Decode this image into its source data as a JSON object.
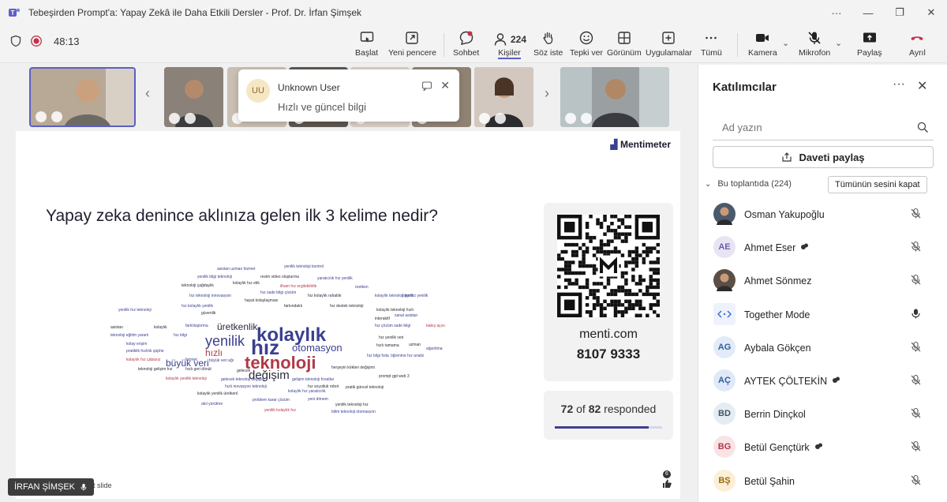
{
  "window": {
    "title": "Tebeşirden Prompt'a: Yapay Zekâ ile Daha Etkili Dersler - Prof. Dr. İrfan Şimşek",
    "controls": {
      "more": "···",
      "minimize": "—",
      "restore": "❐",
      "close": "✕"
    }
  },
  "toolbar": {
    "timer": "48:13",
    "items": {
      "baslat": "Başlat",
      "yeni_pencere": "Yeni pencere",
      "sohbet": "Sohbet",
      "kisiler": "Kişiler",
      "kisiler_count": "224",
      "soz_iste": "Söz iste",
      "tepki_ver": "Tepki ver",
      "gorunum": "Görünüm",
      "uygulamalar": "Uygulamalar",
      "tumu": "Tümü",
      "kamera": "Kamera",
      "mikrofon": "Mikrofon",
      "paylas": "Paylaş",
      "ayril": "Ayrıl"
    },
    "colors": {
      "leave": "#c4314b",
      "record": "#c4314b",
      "accent": "#5b5fc7"
    }
  },
  "popup": {
    "initials": "UU",
    "name": "Unknown User",
    "message": "Hızlı ve güncel bilgi"
  },
  "stage": {
    "brand": "Mentimeter",
    "question": "Yapay zeka denince aklınıza gelen ilk 3 kelime nedir?",
    "menti_url": "menti.com",
    "menti_code": "8107 9333",
    "responded_count": "72",
    "of_word": "of",
    "responded_total": "82",
    "responded_word": "responded",
    "responded_fraction": 0.878,
    "next_slide": "Next slide",
    "reaction_count": "6",
    "word_cloud": [
      {
        "text": "teknoloji",
        "color": "#b03a48"
      },
      {
        "text": "kolaylık",
        "color": "#3a3f8f"
      },
      {
        "text": "hız",
        "color": "#3a3f8f"
      },
      {
        "text": "yenilik",
        "color": "#3a3f8f"
      },
      {
        "text": "değişim",
        "color": "#2a2a3a"
      },
      {
        "text": "otomasyon",
        "color": "#3a3f8f"
      },
      {
        "text": "büyük veri",
        "color": "#3a3f8f"
      },
      {
        "text": "üretkenlik",
        "color": "#2a2a3a"
      },
      {
        "text": "hızlı",
        "color": "#b03a48"
      },
      {
        "text": "asistan uzman hizmet",
        "color": "#3a3f8f"
      },
      {
        "text": "yenilik teknoloji kontrol",
        "color": "#3a3f8f"
      },
      {
        "text": "yenilik bilgi teknoloji",
        "color": "#3a3f8f"
      },
      {
        "text": "resim video oluşturma",
        "color": "#2a2a3a"
      },
      {
        "text": "yaratıcılık hız yenilik",
        "color": "#3a3f8f"
      },
      {
        "text": "kolaylık hız etik",
        "color": "#2a2a3a"
      },
      {
        "text": "teknoloji çağdaşlık",
        "color": "#2a2a3a"
      },
      {
        "text": "ilham hız ergilebilirlik",
        "color": "#b03a48"
      },
      {
        "text": "üretken",
        "color": "#3a3f8f"
      },
      {
        "text": "bilgi hız yenilik",
        "color": "#3a3f8f"
      },
      {
        "text": "hız teknoloji innovasyon",
        "color": "#3a3f8f"
      },
      {
        "text": "hız sade bilgi çözüm",
        "color": "#3a3f8f"
      },
      {
        "text": "hız kolaylık rahatlık",
        "color": "#2a2a3a"
      },
      {
        "text": "kolaylık teknoloji yenili",
        "color": "#3a3f8f"
      },
      {
        "text": "hayat kolaylaşması",
        "color": "#2a2a3a"
      },
      {
        "text": "hız kolaylık yenilik",
        "color": "#3a3f8f"
      },
      {
        "text": "farkındalık",
        "color": "#2a2a3a"
      },
      {
        "text": "hız destek teknoloji",
        "color": "#2a2a3a"
      },
      {
        "text": "kolaylık teknoloji hızlı",
        "color": "#2a2a3a"
      },
      {
        "text": "yenilik hız teknoloji",
        "color": "#3a3f8f"
      },
      {
        "text": "güvenlik",
        "color": "#2a2a3a"
      },
      {
        "text": "interaktif",
        "color": "#2a2a3a"
      },
      {
        "text": "sanal asistan",
        "color": "#3a3f8f"
      },
      {
        "text": "asistan",
        "color": "#2a2a3a"
      },
      {
        "text": "kolaylık",
        "color": "#2a2a3a"
      },
      {
        "text": "farklılaştırma",
        "color": "#3a3f8f"
      },
      {
        "text": "hız çözüm sade bilgi",
        "color": "#3a3f8f"
      },
      {
        "text": "bakış açısı",
        "color": "#b03a48"
      },
      {
        "text": "teknoloji eğitim yararlı",
        "color": "#3a3f8f"
      },
      {
        "text": "hız bilgi",
        "color": "#3a3f8f"
      },
      {
        "text": "kolay erişim",
        "color": "#3a3f8f"
      },
      {
        "text": "hız yenilik veri",
        "color": "#2a2a3a"
      },
      {
        "text": "pratiklik hızlılık şüphe",
        "color": "#3a3f8f"
      },
      {
        "text": "hızlı tamama",
        "color": "#2a2a3a"
      },
      {
        "text": "uzman",
        "color": "#2a2a3a"
      },
      {
        "text": "algoritma",
        "color": "#3a3f8f"
      },
      {
        "text": "kolaylık hız çabasız",
        "color": "#b03a48"
      },
      {
        "text": "hizmet",
        "color": "#3a3f8f"
      },
      {
        "text": "büyük veri ağı",
        "color": "#3a3f8f"
      },
      {
        "text": "hız bilgi fısta",
        "color": "#3a3f8f"
      },
      {
        "text": "öğrenme hız analiz",
        "color": "#3a3f8f"
      },
      {
        "text": "teknoloji gelişim hız",
        "color": "#2a2a3a"
      },
      {
        "text": "hızlı geri dönüt",
        "color": "#2a2a3a"
      },
      {
        "text": "gelecek",
        "color": "#2a2a3a"
      },
      {
        "text": "herşeyin kökten değişimi",
        "color": "#2a2a3a"
      },
      {
        "text": "prompt gpt web 3",
        "color": "#2a2a3a"
      },
      {
        "text": "kolaylık yenilik teknoloji",
        "color": "#b03a48"
      },
      {
        "text": "gelecek teknoloji değişim",
        "color": "#3a3f8f"
      },
      {
        "text": "gelişim teknoloji fırsatlar",
        "color": "#3a3f8f"
      },
      {
        "text": "hızlı inovasyon teknoloji",
        "color": "#3a3f8f"
      },
      {
        "text": "hız soyutluk robot",
        "color": "#2a2a3a"
      },
      {
        "text": "pratik güncel teknoloji",
        "color": "#2a2a3a"
      },
      {
        "text": "kolaylık yenilik üretkenl",
        "color": "#2a2a3a"
      },
      {
        "text": "kolaylık hız yaratıcılık",
        "color": "#3a3f8f"
      },
      {
        "text": "problem karar çözüm",
        "color": "#3a3f8f"
      },
      {
        "text": "yeni dönem",
        "color": "#3a3f8f"
      },
      {
        "text": "yenilik teknoloji hız",
        "color": "#2a2a3a"
      },
      {
        "text": "akıl yürütme",
        "color": "#3a3f8f"
      },
      {
        "text": "yenilik kolaylık hız",
        "color": "#b03a48"
      },
      {
        "text": "bilim teknoloji otomasyon",
        "color": "#3a3f8f"
      }
    ]
  },
  "presenter": {
    "name": "İRFAN ŞİMŞEK"
  },
  "sidebar": {
    "title": "Katılımcılar",
    "more": "···",
    "search_placeholder": "Ad yazın",
    "invite": "Daveti paylaş",
    "section": "Bu toplantıda (224)",
    "mute_all": "Tümünün sesini kapat",
    "participants": [
      {
        "name": "Osman Yakupoğlu",
        "initials": "",
        "avatar_color": "#4a5a6a",
        "text_color": "#ffffff",
        "mic": "muted",
        "badge": false
      },
      {
        "name": "Ahmet Eser",
        "initials": "AE",
        "avatar_color": "#e8e4f4",
        "text_color": "#6b5fa8",
        "mic": "muted",
        "badge": true
      },
      {
        "name": "Ahmet Sönmez",
        "initials": "",
        "avatar_color": "#5a4e46",
        "text_color": "#ffffff",
        "mic": "muted",
        "badge": false
      },
      {
        "name": "Together Mode",
        "initials": "",
        "avatar_color": "#eef2fb",
        "text_color": "#3a6fd8",
        "mic": "on",
        "badge": false
      },
      {
        "name": "Aybala Gökçen",
        "initials": "AG",
        "avatar_color": "#e2ebf7",
        "text_color": "#2f5f9e",
        "mic": "muted",
        "badge": false
      },
      {
        "name": "AYTEK ÇÖLTEKİN",
        "initials": "AÇ",
        "avatar_color": "#e0e9f7",
        "text_color": "#2f5f9e",
        "mic": "muted",
        "badge": true
      },
      {
        "name": "Berrin Dinçkol",
        "initials": "BD",
        "avatar_color": "#e5ecf2",
        "text_color": "#3f5566",
        "mic": "muted",
        "badge": false
      },
      {
        "name": "Betül Gençtürk",
        "initials": "BG",
        "avatar_color": "#f9e3e6",
        "text_color": "#b0394a",
        "mic": "muted",
        "badge": true
      },
      {
        "name": "Betül Şahin",
        "initials": "BŞ",
        "avatar_color": "#fbefd6",
        "text_color": "#9a6a10",
        "mic": "muted",
        "badge": false
      }
    ]
  }
}
